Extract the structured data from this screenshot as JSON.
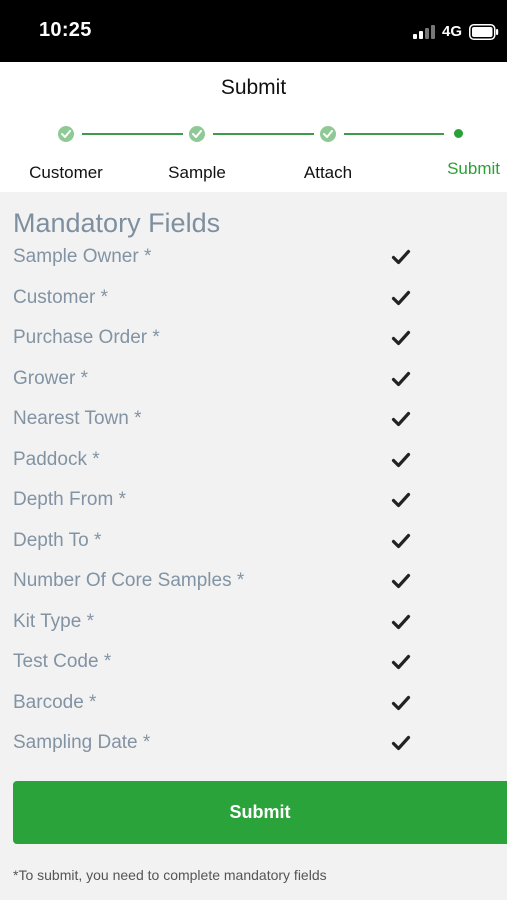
{
  "status_bar": {
    "time": "10:25",
    "network": "4G",
    "icons": [
      "signal-bars-icon",
      "battery-icon"
    ]
  },
  "header": {
    "title": "Submit"
  },
  "stepper": {
    "steps": [
      {
        "label": "Customer",
        "state": "completed",
        "icon": "check-circle-icon"
      },
      {
        "label": "Sample",
        "state": "completed",
        "icon": "check-circle-icon"
      },
      {
        "label": "Attach",
        "state": "completed",
        "icon": "check-circle-icon"
      },
      {
        "label": "Submit",
        "state": "current",
        "icon": "dot-icon"
      }
    ]
  },
  "mandatory": {
    "title": "Mandatory Fields",
    "fields": [
      {
        "label": "Sample Owner *",
        "complete": true
      },
      {
        "label": "Customer *",
        "complete": true
      },
      {
        "label": "Purchase Order *",
        "complete": true
      },
      {
        "label": "Grower *",
        "complete": true
      },
      {
        "label": "Nearest Town *",
        "complete": true
      },
      {
        "label": "Paddock *",
        "complete": true
      },
      {
        "label": "Depth From *",
        "complete": true
      },
      {
        "label": "Depth To *",
        "complete": true
      },
      {
        "label": "Number Of Core Samples *",
        "complete": true
      },
      {
        "label": "Kit Type *",
        "complete": true
      },
      {
        "label": "Test Code *",
        "complete": true
      },
      {
        "label": "Barcode *",
        "complete": true
      },
      {
        "label": "Sampling Date *",
        "complete": true
      }
    ]
  },
  "actions": {
    "submit_label": "Submit"
  },
  "footnote": "*To submit, you need to complete mandatory fields",
  "colors": {
    "accent": "#2aa33a",
    "field_text": "#8293a4",
    "completed_step": "#8fc995"
  }
}
